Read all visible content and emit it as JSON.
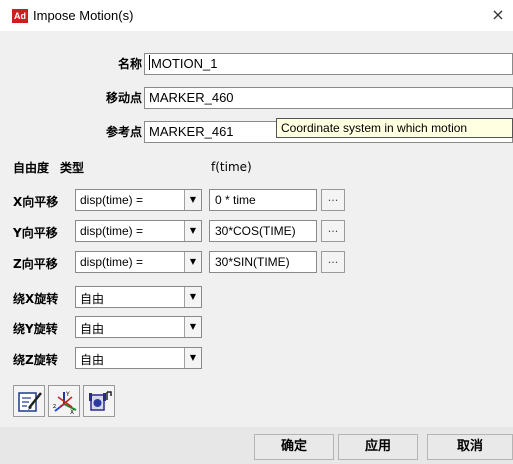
{
  "window": {
    "app_icon_text": "Ad",
    "title": "Impose Motion(s)",
    "close_glyph": "×"
  },
  "form": {
    "name_label": "名称",
    "name_value": "MOTION_1",
    "moving_point_label": "移动点",
    "moving_point_value": "MARKER_460",
    "reference_point_label": "参考点",
    "reference_point_value": "MARKER_461"
  },
  "headers": {
    "dof": "自由度",
    "type": "类型",
    "ftime": "f(time)"
  },
  "tooltip": "Coordinate system in which motion",
  "dof_rows": [
    {
      "label": "X向平移",
      "type": "disp(time) =",
      "expr": "0 * time",
      "browse": "..."
    },
    {
      "label": "Y向平移",
      "type": "disp(time) =",
      "expr": "30*COS(TIME)",
      "browse": "..."
    },
    {
      "label": "Z向平移",
      "type": "disp(time) =",
      "expr": "30*SIN(TIME)",
      "browse": "..."
    },
    {
      "label": "绕X旋转",
      "type": "自由"
    },
    {
      "label": "绕Y旋转",
      "type": "自由"
    },
    {
      "label": "绕Z旋转",
      "type": "自由"
    }
  ],
  "toolbar": {
    "icons": [
      "edit-function-icon",
      "coordinate-system-icon",
      "joint-motion-icon"
    ]
  },
  "buttons": {
    "ok": "确定",
    "apply": "应用",
    "cancel": "取消"
  }
}
